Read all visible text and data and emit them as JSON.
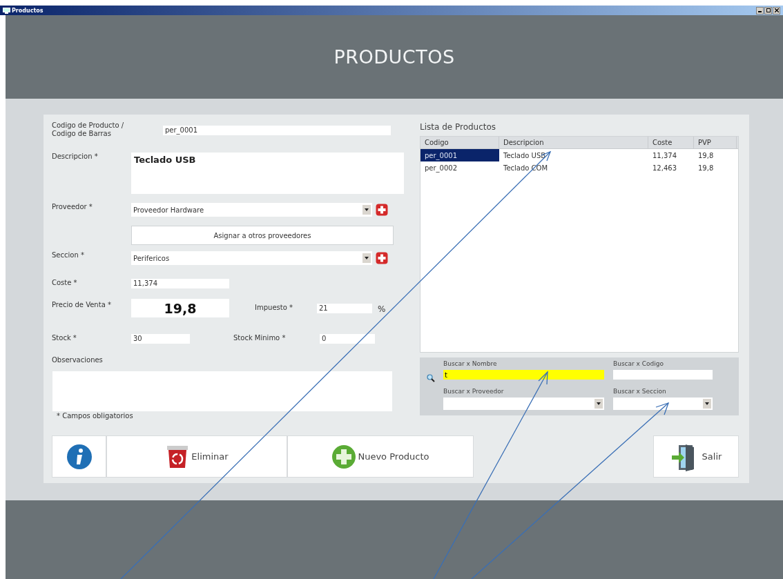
{
  "window": {
    "title": "Productos"
  },
  "header": {
    "title": "PRODUCTOS"
  },
  "form": {
    "codigo": {
      "label": "Codigo de Producto / Codigo de Barras",
      "value": "per_0001"
    },
    "descripcion": {
      "label": "Descripcion *",
      "value": "Teclado USB"
    },
    "proveedor": {
      "label": "Proveedor *",
      "value": "Proveedor Hardware"
    },
    "asignar": {
      "label": "Asignar a otros proveedores"
    },
    "seccion": {
      "label": "Seccion *",
      "value": "Perifericos"
    },
    "coste": {
      "label": "Coste *",
      "value": "11,374"
    },
    "precio": {
      "label": "Precio de Venta *",
      "value": "19,8"
    },
    "impuesto": {
      "label": "Impuesto *",
      "value": "21",
      "unit": "%"
    },
    "stock": {
      "label": "Stock *",
      "value": "30"
    },
    "stock_minimo": {
      "label": "Stock Minimo *",
      "value": "0"
    },
    "observaciones": {
      "label": "Observaciones"
    },
    "note": "* Campos obligatorios"
  },
  "list": {
    "title": "Lista de Productos",
    "columns": [
      "Codigo",
      "Descripcion",
      "Coste",
      "PVP"
    ],
    "rows": [
      {
        "cells": [
          "per_0001",
          "Teclado USB",
          "11,374",
          "19,8"
        ],
        "selected": true
      },
      {
        "cells": [
          "per_0002",
          "Teclado COM",
          "12,463",
          "19,8"
        ],
        "selected": false
      }
    ]
  },
  "search": {
    "fields": [
      {
        "label": "Buscar x Nombre",
        "value": "t",
        "kind": "text",
        "highlighted": true
      },
      {
        "label": "Buscar x Codigo",
        "kind": "text",
        "highlighted": false
      },
      {
        "label": "Buscar x Proveedor",
        "kind": "select",
        "highlighted": false
      },
      {
        "label": "Buscar x Seccion",
        "kind": "select",
        "highlighted": false
      }
    ]
  },
  "buttons": [
    {
      "kind": "info"
    },
    {
      "kind": "delete",
      "label": "Eliminar"
    },
    {
      "kind": "new",
      "label": "Nuevo Producto"
    },
    {
      "kind": "exit",
      "label": "Salir"
    }
  ]
}
